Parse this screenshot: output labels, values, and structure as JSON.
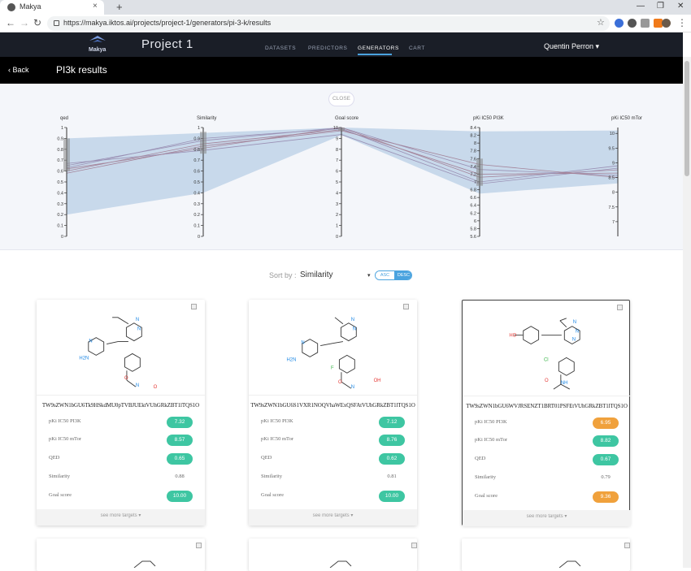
{
  "browser": {
    "tab_title": "Makya",
    "tab_close": "×",
    "new_tab": "+",
    "url": "https://makya.iktos.ai/projects/project-1/generators/pi-3-k/results",
    "win_min": "—",
    "win_max": "❐",
    "win_close": "✕"
  },
  "header": {
    "logo": "Makya",
    "project": "Project 1",
    "nav": [
      "DATASETS",
      "PREDICTORS",
      "GENERATORS",
      "CART"
    ],
    "active_nav": "GENERATORS",
    "user": "Quentin Perron ▾"
  },
  "subheader": {
    "back": "‹  Back",
    "title": "PI3k results"
  },
  "panel": {
    "close": "CLOSE"
  },
  "chart_data": {
    "type": "parallel-coordinates",
    "axes": [
      {
        "name": "qed",
        "ticks": [
          "1",
          "0.9",
          "0.8",
          "0.7",
          "0.6",
          "0.5",
          "0.4",
          "0.3",
          "0.2",
          "0.1",
          "0"
        ],
        "min": 0,
        "max": 1
      },
      {
        "name": "Similarity",
        "ticks": [
          "1",
          "0.9",
          "0.8",
          "0.7",
          "0.6",
          "0.5",
          "0.4",
          "0.3",
          "0.2",
          "0.1",
          "0"
        ],
        "min": 0,
        "max": 1
      },
      {
        "name": "Goal score",
        "ticks": [
          "10",
          "9",
          "8",
          "7",
          "6",
          "5",
          "4",
          "3",
          "2",
          "1",
          "0"
        ],
        "min": 0,
        "max": 10
      },
      {
        "name": "pKi IC50 PI3K",
        "ticks": [
          "8.4",
          "8.2",
          "8",
          "7.8",
          "7.6",
          "7.4",
          "7.2",
          "7",
          "6.8",
          "6.6",
          "6.4",
          "6.2",
          "6",
          "5.8",
          "5.6"
        ],
        "min": 5.6,
        "max": 8.4
      },
      {
        "name": "pKi IC50 mTor",
        "ticks": [
          "10",
          "9.5",
          "9",
          "8.5",
          "8",
          "7.5",
          "7"
        ],
        "min": 6.5,
        "max": 10.2
      }
    ],
    "lines": [
      [
        0.65,
        0.88,
        10.0,
        7.32,
        8.57
      ],
      [
        0.62,
        0.81,
        10.0,
        7.12,
        8.76
      ],
      [
        0.67,
        0.79,
        9.36,
        6.95,
        8.82
      ],
      [
        0.6,
        0.85,
        9.8,
        7.2,
        8.65
      ],
      [
        0.63,
        0.9,
        9.9,
        7.0,
        8.9
      ],
      [
        0.58,
        0.83,
        9.7,
        7.45,
        8.5
      ]
    ],
    "band_min": [
      0.2,
      0.4,
      9.3,
      6.7,
      8.3
    ],
    "band_max": [
      0.9,
      0.95,
      10.0,
      8.3,
      10.1
    ],
    "brush": [
      [
        0.6,
        0.9
      ],
      [
        0.76,
        0.96
      ],
      [
        9.7,
        10.0
      ],
      [
        6.9,
        7.6
      ],
      null
    ]
  },
  "sort": {
    "label": "Sort by :",
    "value": "Similarity",
    "caret": "▾",
    "asc": "ASC",
    "desc": "DESC"
  },
  "cards": [
    {
      "id": "TW9sZWN1bGU6Tk9HSkdMU0pTVBJUEktVUhGRkZBT1lTQS1O",
      "rows": [
        {
          "label": "pKi IC50 PI3K",
          "value": "7.32",
          "color": "#3ec6a2"
        },
        {
          "label": "pKi IC50 mTor",
          "value": "8.57",
          "color": "#3ec6a2"
        },
        {
          "label": "QED",
          "value": "0.65",
          "color": "#3ec6a2"
        },
        {
          "label": "Similarity",
          "value": "0.88",
          "color": ""
        },
        {
          "label": "Goal score",
          "value": "10.00",
          "color": "#3ec6a2"
        }
      ],
      "see_more": "see more targets ▾"
    },
    {
      "id": "TW9sZWN1bGU6S1VXR1NOQVhaWExQSFAtVUhGRkZBT1lTQS1O",
      "rows": [
        {
          "label": "pKi IC50 PI3K",
          "value": "7.12",
          "color": "#3ec6a2"
        },
        {
          "label": "pKi IC50 mTor",
          "value": "8.76",
          "color": "#3ec6a2"
        },
        {
          "label": "QED",
          "value": "0.62",
          "color": "#3ec6a2"
        },
        {
          "label": "Similarity",
          "value": "0.81",
          "color": ""
        },
        {
          "label": "Goal score",
          "value": "10.00",
          "color": "#3ec6a2"
        }
      ],
      "see_more": "see more targets ▾"
    },
    {
      "id": "TW9sZWN1bGU6WVJRSENZT1BRT01PSFEtVUhGRkZBT1lTQS1O",
      "rows": [
        {
          "label": "pKi IC50 PI3K",
          "value": "6.95",
          "color": "#f0a13c"
        },
        {
          "label": "pKi IC50 mTor",
          "value": "8.82",
          "color": "#3ec6a2"
        },
        {
          "label": "QED",
          "value": "0.67",
          "color": "#3ec6a2"
        },
        {
          "label": "Similarity",
          "value": "0.79",
          "color": ""
        },
        {
          "label": "Goal score",
          "value": "9.36",
          "color": "#f0a13c"
        }
      ],
      "see_more": "see more targets ▾"
    }
  ],
  "molecule_atoms": [
    [
      "N",
      "H2N",
      "N",
      "N",
      "O",
      "N",
      "O"
    ],
    [
      "N",
      "H2N",
      "N",
      "N",
      "F",
      "O",
      "N",
      "OH"
    ],
    [
      "N",
      "HO",
      "N",
      "N",
      "Cl",
      "O",
      "NH"
    ]
  ]
}
